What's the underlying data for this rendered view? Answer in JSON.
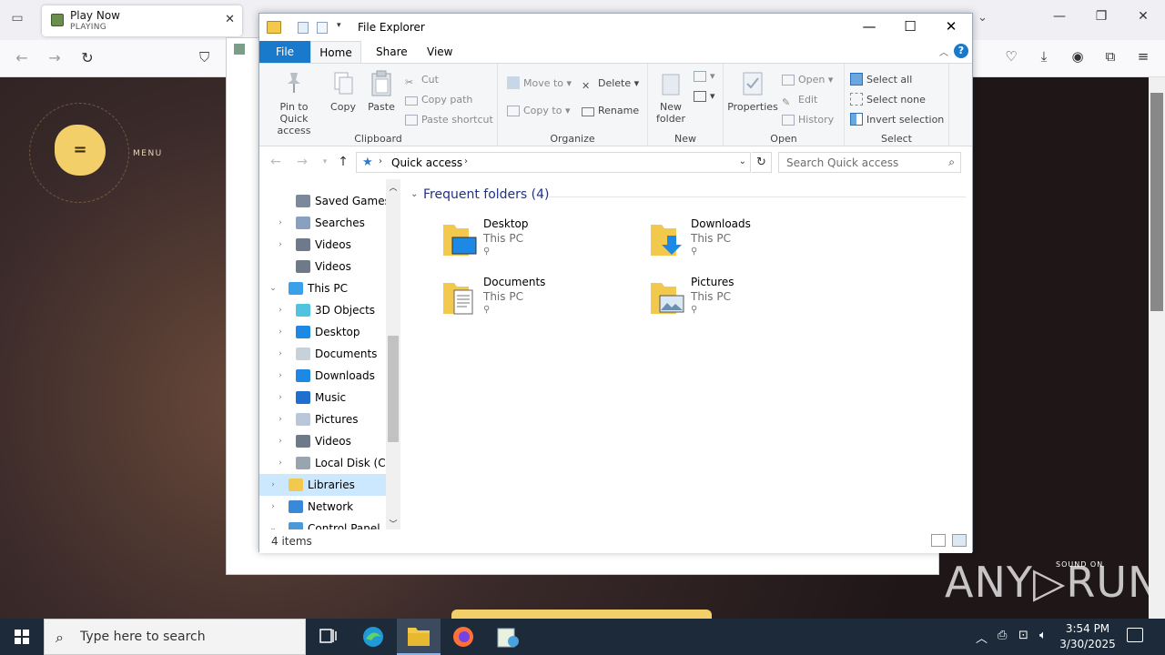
{
  "browser": {
    "tab": {
      "title": "Play Now",
      "subtitle": "PLAYING"
    },
    "window_controls": {
      "minimize": "—",
      "restore": "❐",
      "close": "✕"
    }
  },
  "page": {
    "menu_label": "MENU",
    "sound_label": "SOUND ON",
    "watermark": "ANY▷RUN"
  },
  "explorer": {
    "title": "File Explorer",
    "tabs": [
      "File",
      "Home",
      "Share",
      "View"
    ],
    "ribbon": {
      "clipboard": {
        "label": "Clipboard",
        "pin": "Pin to Quick access",
        "copy": "Copy",
        "paste": "Paste",
        "cut": "Cut",
        "copy_path": "Copy path",
        "paste_shortcut": "Paste shortcut"
      },
      "organize": {
        "label": "Organize",
        "move_to": "Move to",
        "copy_to": "Copy to",
        "delete": "Delete",
        "rename": "Rename"
      },
      "new": {
        "label": "New",
        "new_folder": "New folder"
      },
      "open": {
        "label": "Open",
        "properties": "Properties",
        "open": "Open",
        "edit": "Edit",
        "history": "History"
      },
      "select": {
        "label": "Select",
        "select_all": "Select all",
        "select_none": "Select none",
        "invert": "Invert selection"
      }
    },
    "address": {
      "location": "Quick access",
      "search_placeholder": "Search Quick access"
    },
    "nav_items": [
      {
        "label": "Saved Games",
        "icon": "saved-games-icon"
      },
      {
        "label": "Searches",
        "icon": "search-icon"
      },
      {
        "label": "Videos",
        "icon": "video-icon"
      },
      {
        "label": "Videos",
        "icon": "video-icon"
      },
      {
        "label": "This PC",
        "icon": "computer-icon"
      },
      {
        "label": "3D Objects",
        "icon": "3d-objects-icon"
      },
      {
        "label": "Desktop",
        "icon": "desktop-icon"
      },
      {
        "label": "Documents",
        "icon": "documents-icon"
      },
      {
        "label": "Downloads",
        "icon": "downloads-icon"
      },
      {
        "label": "Music",
        "icon": "music-icon"
      },
      {
        "label": "Pictures",
        "icon": "pictures-icon"
      },
      {
        "label": "Videos",
        "icon": "video-icon"
      },
      {
        "label": "Local Disk (C:)",
        "icon": "drive-icon"
      },
      {
        "label": "Libraries",
        "icon": "libraries-icon"
      },
      {
        "label": "Network",
        "icon": "network-icon"
      },
      {
        "label": "Control Panel",
        "icon": "control-panel-icon"
      }
    ],
    "section_title": "Frequent folders (4)",
    "folders": [
      {
        "name": "Desktop",
        "location": "This PC"
      },
      {
        "name": "Downloads",
        "location": "This PC"
      },
      {
        "name": "Documents",
        "location": "This PC"
      },
      {
        "name": "Pictures",
        "location": "This PC"
      }
    ],
    "status": "4 items"
  },
  "taskbar": {
    "search_placeholder": "Type here to search",
    "time": "3:54 PM",
    "date": "3/30/2025"
  },
  "colors": {
    "accent": "#1979ca",
    "selection": "#cce8ff",
    "folder": "#f2c94c",
    "taskbar": "#1c2a3a"
  }
}
